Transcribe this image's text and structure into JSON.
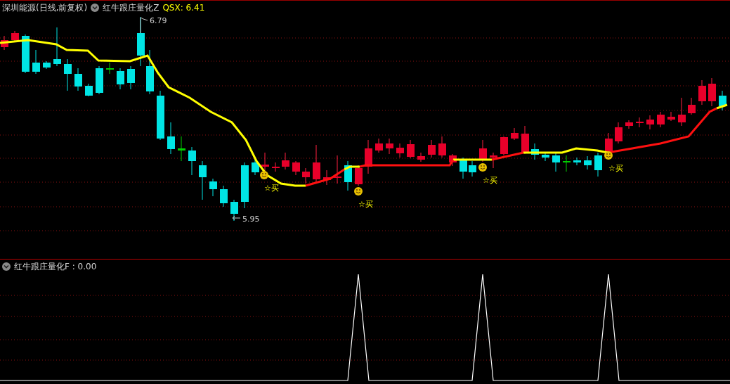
{
  "header": {
    "stock": "深圳能源(日线,前复权)",
    "indicator": "红牛跟庄量化Z",
    "value_label": "QSX: 6.41"
  },
  "price_labels": [
    {
      "kind": "high",
      "text": "6.79"
    },
    {
      "kind": "low",
      "text": "5.95"
    }
  ],
  "signals": [
    {
      "text": "☆买"
    },
    {
      "text": "☆买"
    },
    {
      "text": "☆买"
    },
    {
      "text": "☆买"
    }
  ],
  "lower_panel": {
    "title": "红牛跟庄量化F : 0.00"
  }
}
